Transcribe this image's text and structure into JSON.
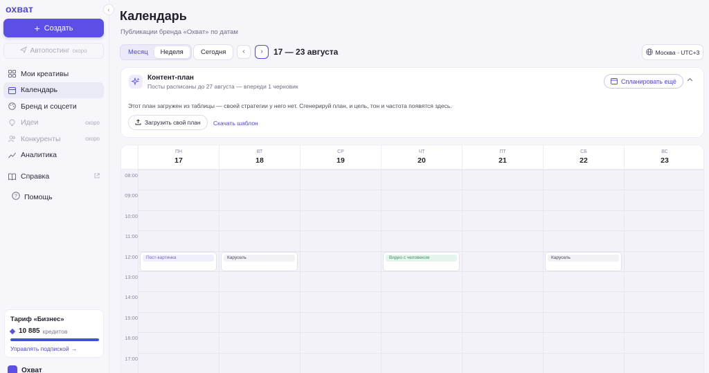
{
  "sidebar": {
    "logo": "охват",
    "create_label": "Создать",
    "autopost_label": "Автопостинг",
    "autopost_badge": "скоро",
    "items": [
      {
        "label": "Мои креативы",
        "icon": "grid-icon"
      },
      {
        "label": "Календарь",
        "icon": "calendar-icon",
        "active": true
      },
      {
        "label": "Бренд и соцсети",
        "icon": "palette-icon"
      },
      {
        "label": "Идеи",
        "icon": "lightbulb-icon",
        "badge": "скоро"
      },
      {
        "label": "Конкуренты",
        "icon": "people-icon",
        "badge": "скоро"
      },
      {
        "label": "Аналитика",
        "icon": "chart-icon"
      },
      {
        "label": "Справка",
        "icon": "book-icon"
      }
    ],
    "help_label": "Помощь",
    "plan": {
      "title": "Тариф «Бизнес»",
      "credits": "10 885",
      "credits_unit": "кредитов",
      "progress": 1.0,
      "manage_label": "Управлять подпиской"
    },
    "org_name": "Охват"
  },
  "header": {
    "title": "Календарь",
    "subtitle": "Публикации бренда «Охват» по датам"
  },
  "toolbar": {
    "month_label": "Месяц",
    "week_label": "Неделя",
    "today_label": "Сегодня",
    "range_label": "17 — 23 августа",
    "timezone_label": "Москва · UTC+3"
  },
  "content_plan": {
    "title": "Контент-план",
    "subtitle": "Посты расписаны до 27 августа — впереди 1 черновик",
    "plan_more_label": "Спланировать ещё",
    "description": "Этот план загружен из таблицы — своей стратегии у него нет. Сгенерируй план, и цель, тон и частота появятся здесь.",
    "upload_label": "Загрузить свой план",
    "template_label": "Скачать шаблон"
  },
  "calendar": {
    "days": [
      {
        "dow": "пн",
        "num": "17"
      },
      {
        "dow": "вт",
        "num": "18"
      },
      {
        "dow": "ср",
        "num": "19"
      },
      {
        "dow": "чт",
        "num": "20"
      },
      {
        "dow": "пт",
        "num": "21"
      },
      {
        "dow": "сб",
        "num": "22"
      },
      {
        "dow": "вс",
        "num": "23"
      }
    ],
    "hours": [
      "08:00",
      "09:00",
      "10:00",
      "11:00",
      "12:00",
      "13:00",
      "14:00",
      "15:00",
      "16:00",
      "17:00"
    ],
    "events": [
      {
        "day": 0,
        "hour": "12:00",
        "label": "Пост-картинка",
        "style": "purple"
      },
      {
        "day": 1,
        "hour": "12:00",
        "label": "Карусель",
        "style": "gray"
      },
      {
        "day": 3,
        "hour": "12:00",
        "label": "Видео с человеком",
        "style": "green"
      },
      {
        "day": 5,
        "hour": "12:00",
        "label": "Карусель",
        "style": "gray"
      }
    ]
  },
  "colors": {
    "accent": "#5b4fe6",
    "link": "#4d46e0"
  }
}
